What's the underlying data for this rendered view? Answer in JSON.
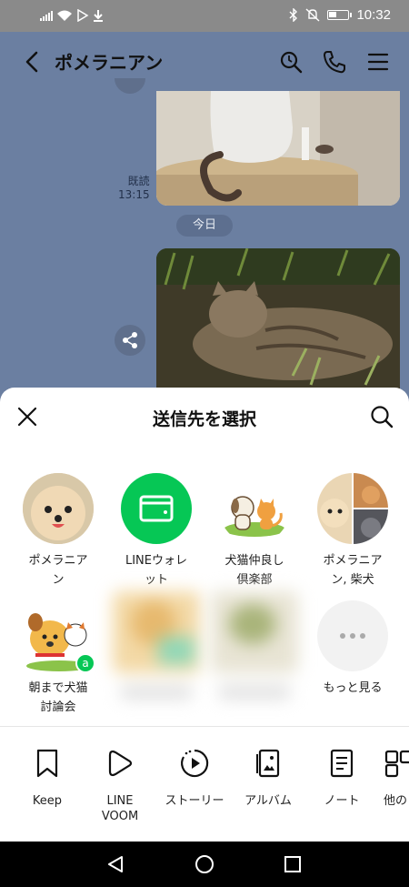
{
  "status": {
    "time": "10:32"
  },
  "header": {
    "title": "ポメラニアン"
  },
  "chat": {
    "read_label": "既読",
    "read_time": "13:15",
    "date_pill": "今日"
  },
  "sheet": {
    "title": "送信先を選択",
    "contacts": [
      {
        "label": "ポメラニア\nン"
      },
      {
        "label": "LINEウォレ\nット"
      },
      {
        "label": "犬猫仲良し\n倶楽部"
      },
      {
        "label": "ポメラニア\nン, 柴犬"
      },
      {
        "label": "朝まで犬猫\n討論会"
      },
      {
        "label": ""
      },
      {
        "label": ""
      },
      {
        "label": "もっと見る"
      }
    ],
    "actions": [
      {
        "label": "Keep",
        "icon": "bookmark-icon"
      },
      {
        "label": "LINE\nVOOM",
        "icon": "play-icon"
      },
      {
        "label": "ストーリー",
        "icon": "story-icon"
      },
      {
        "label": "アルバム",
        "icon": "album-icon"
      },
      {
        "label": "ノート",
        "icon": "note-icon"
      },
      {
        "label": "他の",
        "icon": "grid-icon"
      }
    ]
  },
  "colors": {
    "line_green": "#06c755",
    "chat_bg": "#6b7fa1"
  }
}
